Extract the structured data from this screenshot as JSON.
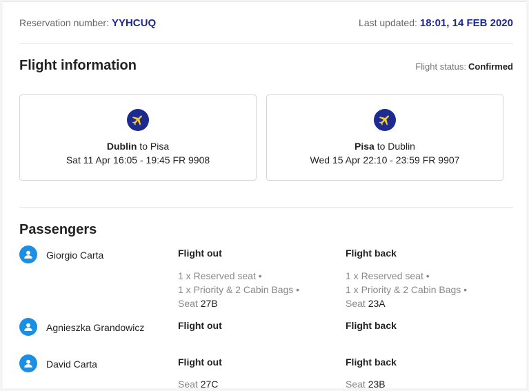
{
  "reservation": {
    "label": "Reservation number:",
    "number": "YYHCUQ"
  },
  "updated": {
    "label": "Last updated:",
    "value": "18:01, 14 FEB 2020"
  },
  "flight_info": {
    "title": "Flight information",
    "status_label": "Flight status:",
    "status_value": "Confirmed",
    "flights": [
      {
        "from": "Dublin",
        "to_word": " to ",
        "to": "Pisa",
        "details": "Sat 11 Apr 16:05 - 19:45 FR 9908",
        "icon": "plane-icon"
      },
      {
        "from": "Pisa",
        "to_word": " to ",
        "to": "Dublin",
        "details": "Wed 15 Apr 22:10 - 23:59 FR 9907",
        "icon": "plane-icon"
      }
    ]
  },
  "passengers": {
    "title": "Passengers",
    "flight_out_label": "Flight out",
    "flight_back_label": "Flight back",
    "list": [
      {
        "name": "Giorgio Carta",
        "out": {
          "line1": "1 x Reserved seat •",
          "line2": "1 x Priority & 2 Cabin Bags •",
          "seat_label": "Seat ",
          "seat": "27B"
        },
        "back": {
          "line1": "1 x Reserved seat •",
          "line2": "1 x Priority & 2 Cabin Bags •",
          "seat_label": "Seat ",
          "seat": "23A"
        }
      },
      {
        "name": "Agnieszka Grandowicz"
      },
      {
        "name": "David Carta",
        "out": {
          "seat_label": "Seat ",
          "seat": "27C"
        },
        "back": {
          "seat_label": "Seat ",
          "seat": "23B"
        }
      }
    ]
  },
  "colors": {
    "brand_navy": "#1d2a8f",
    "flight_icon_yellow": "#f1c933",
    "avatar_blue": "#1a8fe3"
  }
}
